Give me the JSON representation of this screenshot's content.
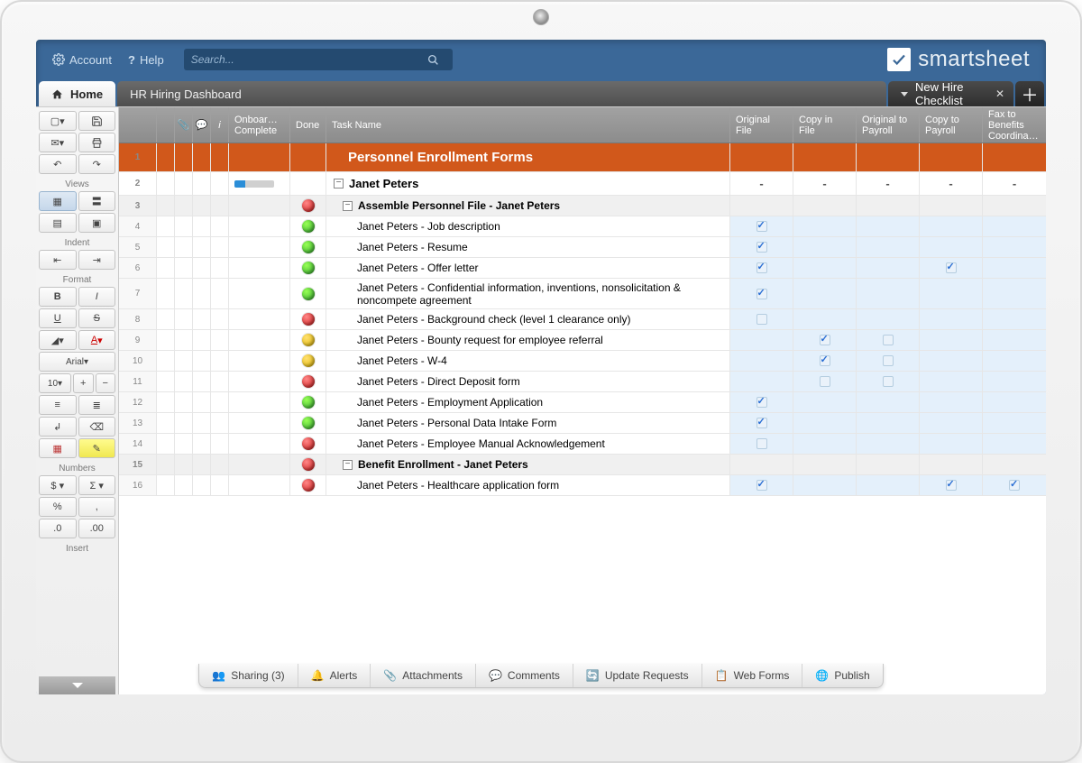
{
  "topbar": {
    "account": "Account",
    "help": "Help",
    "search_placeholder": "Search...",
    "brand": "smartsheet"
  },
  "tabs": {
    "home": "Home",
    "dashboard": "HR Hiring Dashboard",
    "active": "New Hire Checklist"
  },
  "toolbar": {
    "views": "Views",
    "indent": "Indent",
    "format": "Format",
    "font": "Arial",
    "size": "10",
    "numbers": "Numbers",
    "insert": "Insert"
  },
  "columns": {
    "onboard": "Onboar… Complete",
    "done": "Done",
    "task": "Task Name",
    "c1": "Original File",
    "c2": "Copy in File",
    "c3": "Original to Payroll",
    "c4": "Copy to Payroll",
    "c5": "Fax to Benefits Coordina…"
  },
  "section": "Personnel Enrollment Forms",
  "person": "Janet Peters",
  "group1": "Assemble Personnel File - Janet Peters",
  "group2": "Benefit Enrollment - Janet Peters",
  "rows": [
    {
      "n": 4,
      "d": "g",
      "t": "Janet Peters - Job description",
      "c": [
        true,
        null,
        null,
        null,
        null
      ]
    },
    {
      "n": 5,
      "d": "g",
      "t": "Janet Peters - Resume",
      "c": [
        true,
        null,
        null,
        null,
        null
      ]
    },
    {
      "n": 6,
      "d": "g",
      "t": "Janet Peters - Offer letter",
      "c": [
        true,
        null,
        null,
        true,
        null
      ]
    },
    {
      "n": 7,
      "d": "g",
      "t": "Janet Peters - Confidential information, inventions, nonsolicitation & noncompete agreement",
      "c": [
        true,
        null,
        null,
        null,
        null
      ]
    },
    {
      "n": 8,
      "d": "r",
      "t": "Janet Peters - Background check (level 1 clearance only)",
      "c": [
        false,
        null,
        null,
        null,
        null
      ]
    },
    {
      "n": 9,
      "d": "y",
      "t": "Janet Peters - Bounty request for employee referral",
      "c": [
        null,
        true,
        false,
        null,
        null
      ]
    },
    {
      "n": 10,
      "d": "y",
      "t": "Janet Peters - W-4",
      "c": [
        null,
        true,
        false,
        null,
        null
      ]
    },
    {
      "n": 11,
      "d": "r",
      "t": "Janet Peters - Direct Deposit form",
      "c": [
        null,
        false,
        false,
        null,
        null
      ]
    },
    {
      "n": 12,
      "d": "g",
      "t": "Janet Peters - Employment Application",
      "c": [
        true,
        null,
        null,
        null,
        null
      ]
    },
    {
      "n": 13,
      "d": "g",
      "t": "Janet Peters - Personal Data Intake Form",
      "c": [
        true,
        null,
        null,
        null,
        null
      ]
    },
    {
      "n": 14,
      "d": "r",
      "t": "Janet Peters - Employee Manual Acknowledgement",
      "c": [
        false,
        null,
        null,
        null,
        null
      ]
    }
  ],
  "group2_status": "r",
  "row16": {
    "n": 16,
    "d": "r",
    "t": "Janet Peters - Healthcare application form",
    "c": [
      true,
      null,
      null,
      true,
      true
    ]
  },
  "footer": {
    "sharing": "Sharing  (3)",
    "alerts": "Alerts",
    "attachments": "Attachments",
    "comments": "Comments",
    "updates": "Update Requests",
    "forms": "Web Forms",
    "publish": "Publish"
  }
}
